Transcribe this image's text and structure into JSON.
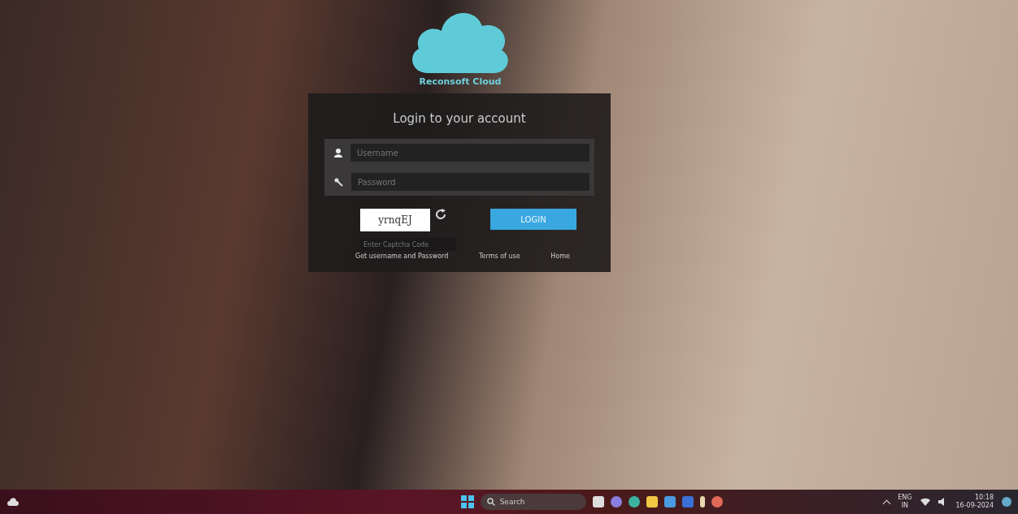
{
  "brand": {
    "name": "Reconsoft Cloud"
  },
  "login": {
    "title": "Login to your account",
    "username": {
      "placeholder": "Username"
    },
    "password": {
      "placeholder": "Password"
    },
    "captcha": {
      "code": "yrnqEJ",
      "placeholder": "Enter Captcha Code"
    },
    "button": "LOGIN",
    "links": [
      "Get username and Password",
      "Terms of use",
      "Home"
    ]
  },
  "taskbar": {
    "search": {
      "placeholder": "Search"
    },
    "tray": {
      "language": "ENG",
      "region": "IN",
      "time": "10:18",
      "date": "16-09-2024"
    }
  }
}
